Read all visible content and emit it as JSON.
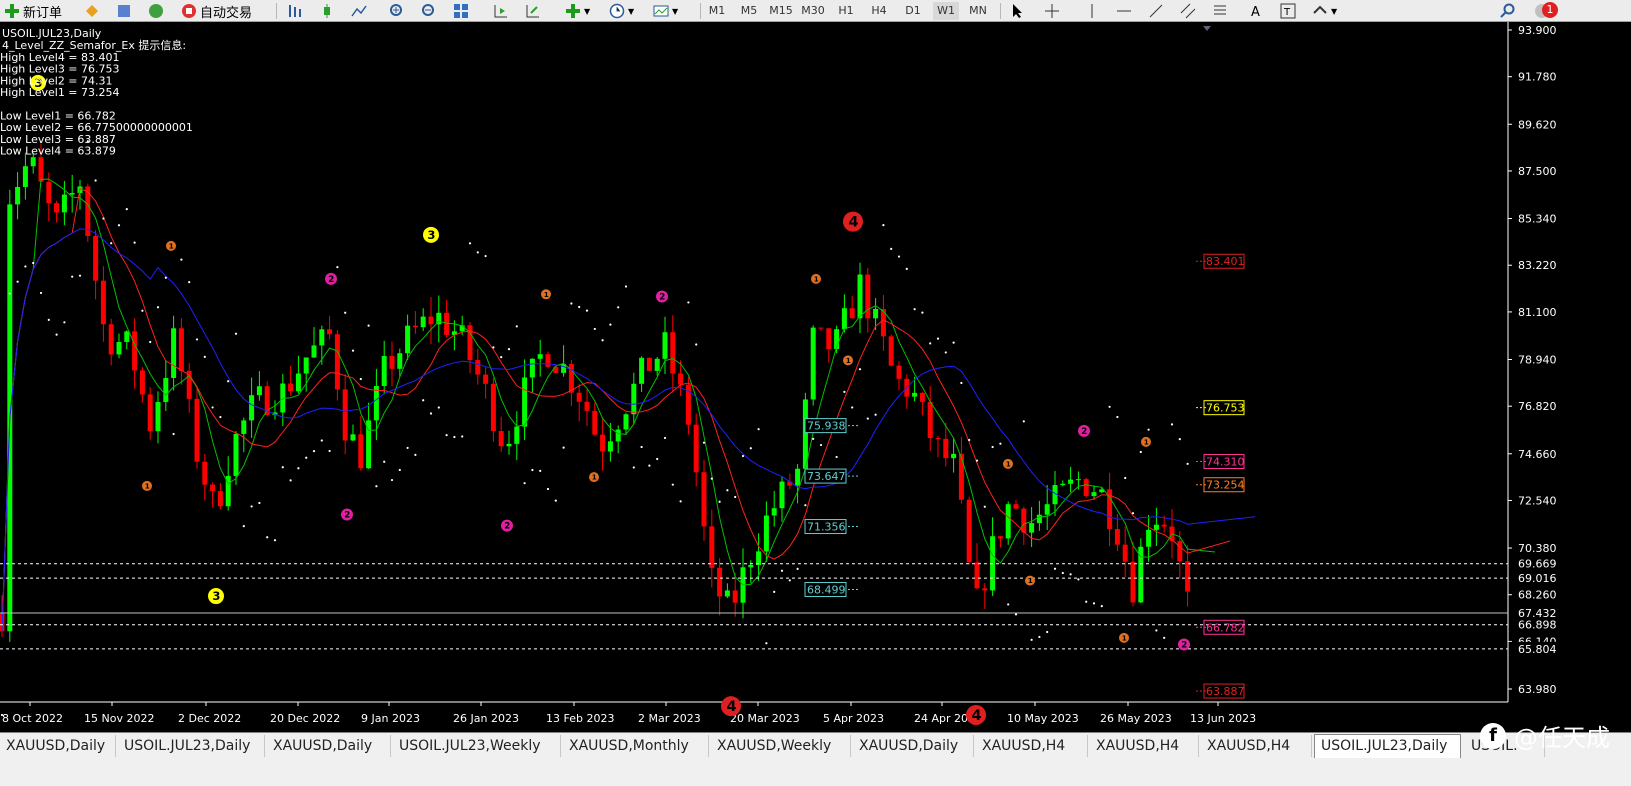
{
  "toolbar": {
    "new_order": "新订单",
    "auto_trading": "自动交易",
    "timeframes": [
      "M1",
      "M5",
      "M15",
      "M30",
      "H1",
      "H4",
      "D1",
      "W1",
      "MN"
    ],
    "active_timeframe": "W1",
    "alert_badge": "1"
  },
  "chart": {
    "symbol_line": "USOIL.JUL23,Daily",
    "indicator_line": "4_Level_ZZ_Semafor_Ex 提示信息:",
    "levels_text": [
      "High Level4 = 83.401",
      "High Level3 = 76.753",
      "High Level2 = 74.31",
      "High Level1 = 73.254",
      "",
      "Low Level1 = 66.782",
      "Low Level2 = 66.77500000000001",
      "Low Level3 = 63.887",
      "Low Level4 = 63.879"
    ],
    "price_axis": [
      "93.900",
      "91.780",
      "89.620",
      "87.500",
      "85.340",
      "83.220",
      "81.100",
      "78.940",
      "76.820",
      "74.660",
      "72.540",
      "70.380",
      "68.260",
      "66.140",
      "63.980"
    ],
    "date_axis": [
      "8 Oct 2022",
      "15 Nov 2022",
      "2 Dec 2022",
      "20 Dec 2022",
      "9 Jan 2023",
      "26 Jan 2023",
      "13 Feb 2023",
      "2 Mar 2023",
      "20 Mar 2023",
      "5 Apr 2023",
      "24 Apr 2023",
      "10 May 2023",
      "26 May 2023",
      "13 Jun 2023"
    ],
    "right_labels": [
      {
        "text": "83.401",
        "price": 83.401,
        "color": "#e02020"
      },
      {
        "text": "76.753",
        "price": 76.753,
        "color": "#ffff00"
      },
      {
        "text": "74.310",
        "price": 74.31,
        "color": "#ff3399"
      },
      {
        "text": "73.254",
        "price": 73.254,
        "color": "#ff7f27"
      },
      {
        "text": "66.782",
        "price": 66.782,
        "color": "#ff3399"
      },
      {
        "text": "63.887",
        "price": 63.887,
        "color": "#e02020"
      }
    ],
    "axis_markers": [
      {
        "text": "69.669",
        "price": 69.669
      },
      {
        "text": "69.016",
        "price": 69.016
      },
      {
        "text": "67.432",
        "price": 67.432
      },
      {
        "text": "66.898",
        "price": 66.898
      },
      {
        "text": "65.804",
        "price": 65.804
      }
    ],
    "boxed_labels": [
      {
        "text": "75.938",
        "price": 75.938
      },
      {
        "text": "73.647",
        "price": 73.647
      },
      {
        "text": "71.356",
        "price": 71.356
      },
      {
        "text": "68.499",
        "price": 68.499
      }
    ],
    "colors": {
      "bull": "#00ff00",
      "bear": "#ff0000",
      "ma_fast": "#00c000",
      "ma_mid": "#ff2020",
      "ma_slow": "#2020ff",
      "sar": "#ffffff",
      "grid": "#000000"
    }
  },
  "tabs": [
    "XAUUSD,Daily",
    "USOIL.JUL23,Daily",
    "XAUUSD,Daily",
    "USOIL.JUL23,Weekly",
    "XAUUSD,Monthly",
    "XAUUSD,Weekly",
    "XAUUSD,Daily",
    "XAUUSD,H4",
    "XAUUSD,H4",
    "XAUUSD,H4",
    "USOIL.JUL23,Daily",
    "USOIL."
  ],
  "active_tab": 10,
  "watermark": "@任天成"
}
